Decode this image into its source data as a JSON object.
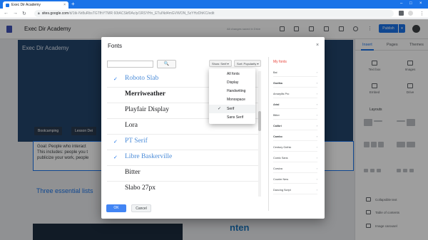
{
  "browser": {
    "tab_title": "Exec Dir Academy",
    "tab_close": "×",
    "new_tab": "+",
    "url_host": "sites.google.com",
    "url_path": "/d/1tk-Nr8uRbsTGTfhYTMR 60tACSkf0Ac/p/1RSYHn_ETuINd4mGVWON_5zYHzDhKC/edit",
    "window_controls": [
      "–",
      "□",
      "×"
    ]
  },
  "app": {
    "site_title": "Exec Dir Academy",
    "save_status": "All changes saved in Drive",
    "publish_label": "Publish",
    "publish_dropdown": "▾"
  },
  "page": {
    "banner_title": "Exec Dir Academy",
    "chips": [
      "Bootcamping",
      "Lesson Dei"
    ],
    "goal_line1": "Goal: People who interact",
    "goal_line2": "This includes: people you t",
    "goal_line3": "publicize your work, people",
    "lists_heading": "Three essential lists",
    "partner_logo": "nten"
  },
  "side_panel": {
    "tabs": [
      "Insert",
      "Pages",
      "Themes"
    ],
    "items": [
      "Text box",
      "Images",
      "Embed",
      "Drive"
    ],
    "layouts_label": "Layouts",
    "bottom_items": [
      "Collapsible text",
      "Table of contents",
      "Image carousel"
    ]
  },
  "dialog": {
    "title": "Fonts",
    "close": "×",
    "search_placeholder": "",
    "search_icon": "🔍",
    "filter_label": "Show: Serif ▾",
    "sort_label": "Sort: Popularity ▾",
    "fonts": [
      {
        "name": "Roboto Slab",
        "selected": true
      },
      {
        "name": "Merriweather",
        "selected": false
      },
      {
        "name": "Playfair Display",
        "selected": false
      },
      {
        "name": "Lora",
        "selected": false
      },
      {
        "name": "PT Serif",
        "selected": true
      },
      {
        "name": "Libre Baskerville",
        "selected": true
      },
      {
        "name": "Bitter",
        "selected": false
      },
      {
        "name": "Slabo 27px",
        "selected": false
      }
    ],
    "check_glyph": "✓",
    "my_fonts_title": "My fonts",
    "my_fonts": [
      "Bai",
      "Godika",
      "Amaryllis Pro",
      "Arial",
      "Bitter",
      "Calibri",
      "Cambo",
      "Century Gothic",
      "Comic Sans",
      "Corsiva",
      "Courier New",
      "Dancing Script"
    ],
    "ok_label": "OK",
    "cancel_label": "Cancel"
  },
  "filter_menu": {
    "options": [
      "All fonts",
      "Display",
      "Handwriting",
      "Monospace",
      "Serif",
      "Sans Serif"
    ],
    "selected": "Serif"
  },
  "colors": {
    "accent": "#1a73e8",
    "banner": "#23446b",
    "my_fonts_title": "#e8453c"
  }
}
